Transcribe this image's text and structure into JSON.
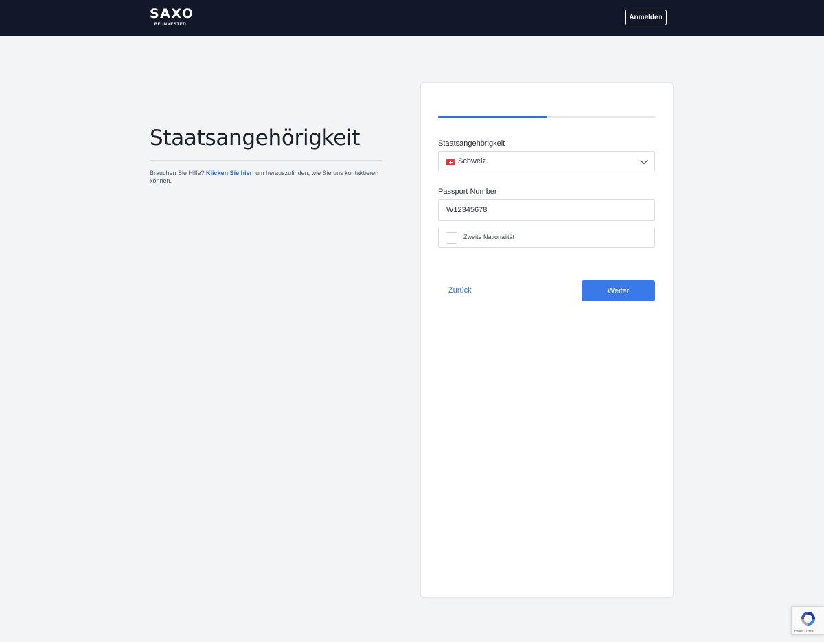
{
  "header": {
    "logo_text": "SAXO",
    "logo_tagline": "BE INVESTED",
    "login_label": "Anmelden"
  },
  "intro": {
    "title": "Staatsangehörigkeit",
    "help_prefix": "Brauchen Sie Hilfe? ",
    "help_link": "Klicken Sie hier",
    "help_suffix": ", um herauszufinden, wie Sie uns kontaktieren können."
  },
  "form": {
    "progress_fraction": 0.5,
    "nationality_label": "Staatsangehörigkeit",
    "nationality_value": "Schweiz",
    "passport_label": "Passport Number",
    "passport_value": "W12345678",
    "second_nationality_label": "Zweite Nationalität",
    "second_nationality_checked": false,
    "back_label": "Zurück",
    "next_label": "Weiter"
  },
  "recaptcha": {
    "text": "Privacy - Terms"
  },
  "colors": {
    "header_bg": "#121829",
    "accent": "#2f6ed9",
    "primary_button": "#3a7ae8",
    "page_bg": "#f3f4f6"
  },
  "icons": {
    "flag": "swiss-flag-icon",
    "dropdown": "chevron-down-icon",
    "captcha": "recaptcha-icon"
  }
}
